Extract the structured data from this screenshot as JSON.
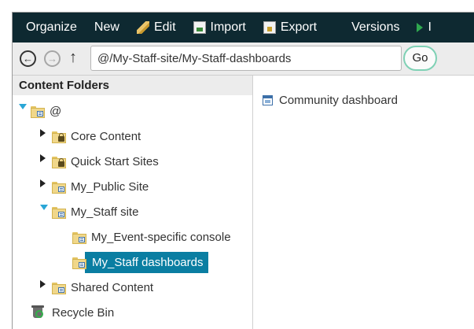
{
  "toolbar": {
    "organize": "Organize",
    "new": "New",
    "edit": "Edit",
    "import": "Import",
    "export": "Export",
    "versions": "Versions",
    "cut_label": "I"
  },
  "address": {
    "back_glyph": "←",
    "forward_glyph": "→",
    "up_glyph": "↑",
    "path": "@/My-Staff-site/My-Staff-dashboards",
    "go_label": "Go"
  },
  "left_panel": {
    "header": "Content Folders",
    "tree": [
      {
        "label": "@"
      },
      {
        "label": "Core Content"
      },
      {
        "label": "Quick Start Sites"
      },
      {
        "label": "My_Public Site"
      },
      {
        "label": "My_Staff site"
      },
      {
        "label": "My_Event-specific console"
      },
      {
        "label": "My_Staff dashboards"
      },
      {
        "label": "Shared Content"
      },
      {
        "label": "Recycle Bin"
      }
    ],
    "selected_index": 6
  },
  "right_panel": {
    "items": [
      {
        "label": "Community dashboard"
      }
    ]
  },
  "colors": {
    "toolbar_bg": "#0e2931",
    "selected_bg": "#0a7ea2",
    "go_border": "#7fd1b5",
    "expand_arrow": "#2aa6d6"
  },
  "icons": {
    "edit": "pencil-icon",
    "import": "import-icon",
    "export": "export-icon",
    "versions": "versions-icon",
    "run": "play-icon"
  }
}
